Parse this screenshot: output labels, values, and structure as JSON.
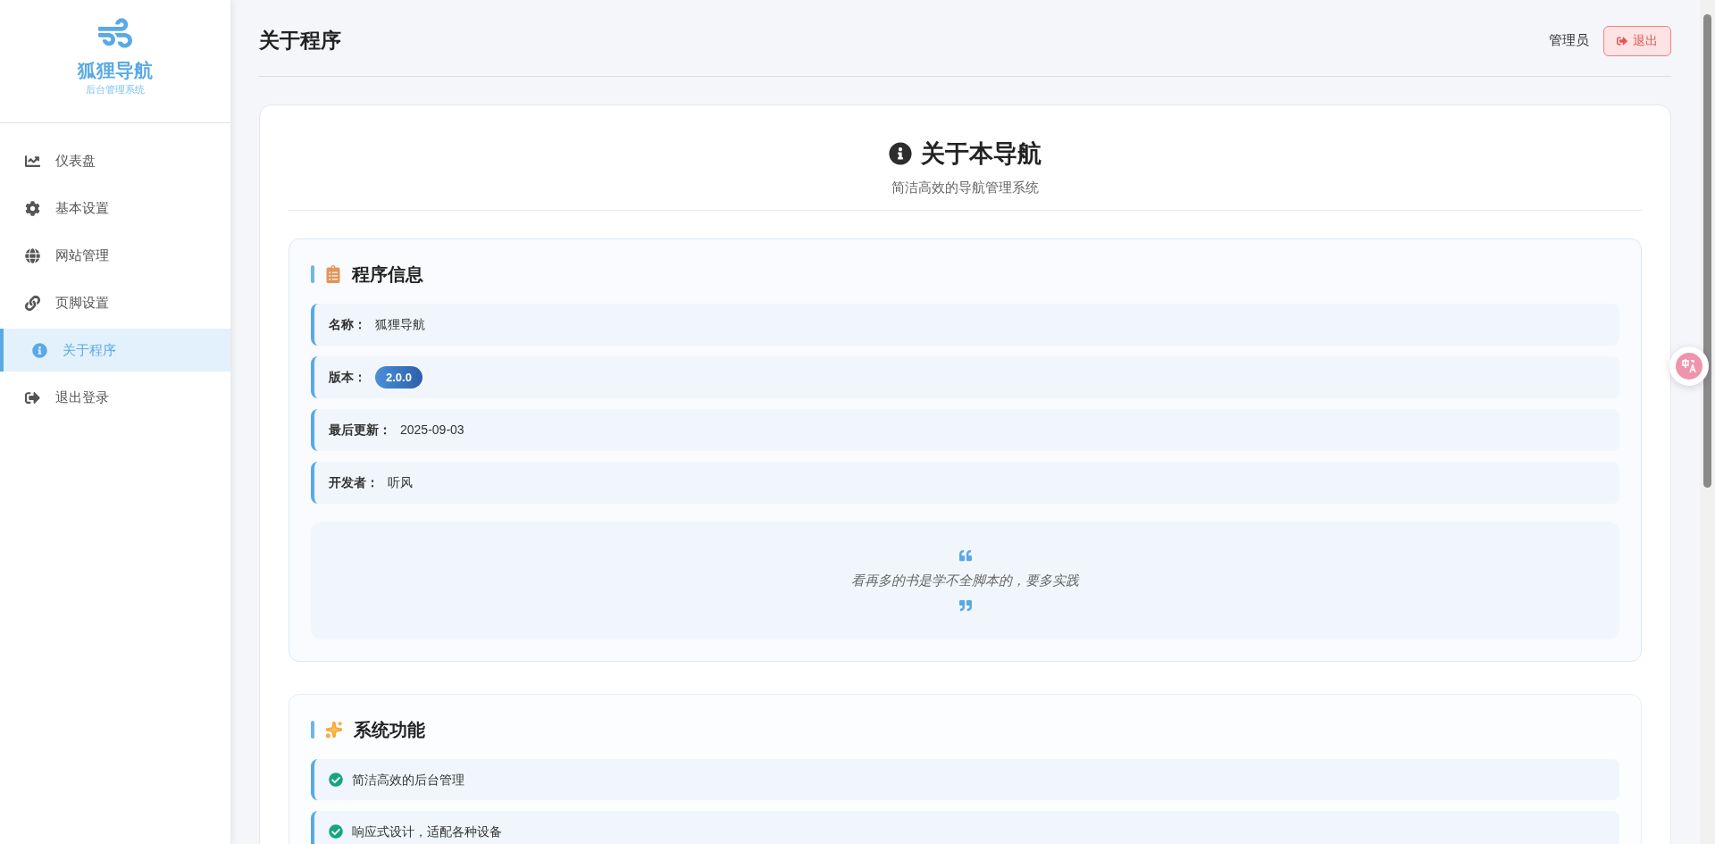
{
  "sidebar": {
    "brand": "狐狸导航",
    "subtitle": "后台管理系统",
    "items": [
      {
        "kind": "chart",
        "label": "仪表盘",
        "selected": false
      },
      {
        "kind": "gear",
        "label": "基本设置",
        "selected": false
      },
      {
        "kind": "globe",
        "label": "网站管理",
        "selected": false
      },
      {
        "kind": "link",
        "label": "页脚设置",
        "selected": false
      },
      {
        "kind": "info",
        "label": "关于程序",
        "selected": true
      },
      {
        "kind": "logout",
        "label": "退出登录",
        "selected": false
      }
    ]
  },
  "header": {
    "title": "关于程序",
    "user": "管理员",
    "logout_button": "退出"
  },
  "about": {
    "title": "关于本导航",
    "subtitle": "简洁高效的导航管理系统",
    "info_section": {
      "title": "程序信息",
      "rows": [
        {
          "kind": "text",
          "label": "名称：",
          "value": "狐狸导航"
        },
        {
          "kind": "badge",
          "label": "版本：",
          "value": "2.0.0"
        },
        {
          "kind": "text",
          "label": "最后更新：",
          "value": "2025-09-03"
        },
        {
          "kind": "text",
          "label": "开发者：",
          "value": "听风"
        }
      ],
      "quote": "看再多的书是学不全脚本的，要多实践"
    },
    "features_section": {
      "title": "系统功能",
      "items": [
        "简洁高效的后台管理",
        "响应式设计，适配各种设备"
      ]
    }
  }
}
